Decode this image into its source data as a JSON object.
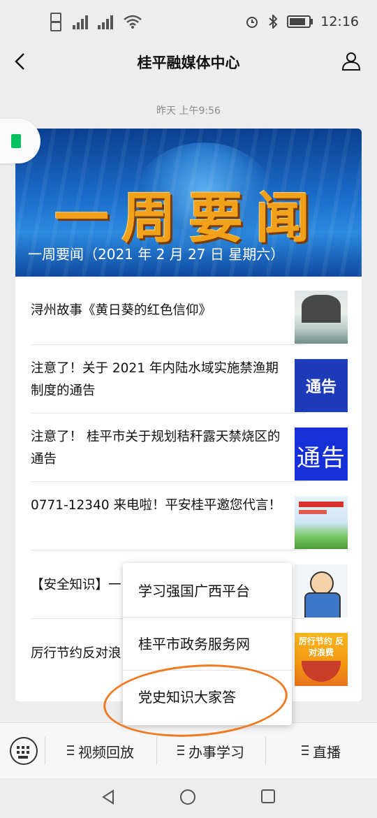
{
  "status_bar": {
    "time": "12:16"
  },
  "header": {
    "title": "桂平融媒体中心"
  },
  "timestamp": "昨天 上午9:56",
  "banner": {
    "title": "一周要闻",
    "caption": "一周要闻（2021 年 2 月 27 日  星期六）"
  },
  "articles": [
    {
      "title": "浔州故事《黄日葵的红色信仰》",
      "thumb": "ink-painting"
    },
    {
      "title": "注意了！关于 2021 年内陆水域实施禁渔期制度的通告",
      "thumb": "notice",
      "thumb_text": "通告"
    },
    {
      "title": "注意了！ 桂平市关于规划秸秆露天禁烧区的通告",
      "thumb": "notice",
      "thumb_text": "通告"
    },
    {
      "title": "0771-12340 来电啦！平安桂平邀您代言！",
      "thumb": "poster"
    },
    {
      "title": "【安全知识】一",
      "thumb": "cartoon"
    },
    {
      "title": "厉行节约反对浪",
      "thumb": "food",
      "thumb_text": "厉行节约 反对浪费"
    }
  ],
  "popup_menu": {
    "items": [
      "学习强国广西平台",
      "桂平市政务服务网",
      "党史知识大家答"
    ],
    "highlighted_index": 2
  },
  "bottom_menu": {
    "tabs": [
      "视频回放",
      "办事学习",
      "直播"
    ]
  },
  "colors": {
    "accent_green": "#07c160",
    "banner_blue": "#1a6bc9",
    "annotation_orange": "#f07a22"
  }
}
